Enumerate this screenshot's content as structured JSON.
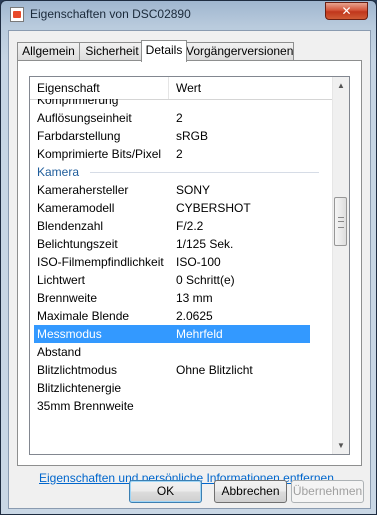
{
  "window": {
    "title": "Eigenschaften von DSC02890",
    "close_label": "✕",
    "close_icon": "close-icon"
  },
  "tabs": [
    {
      "label": "Allgemein"
    },
    {
      "label": "Sicherheit"
    },
    {
      "label": "Details"
    },
    {
      "label": "Vorgängerversionen"
    }
  ],
  "table": {
    "header": {
      "property": "Eigenschaft",
      "value": "Wert"
    },
    "rows": [
      {
        "k": "Komprimierung",
        "v": ""
      },
      {
        "k": "Auflösungseinheit",
        "v": "2"
      },
      {
        "k": "Farbdarstellung",
        "v": "sRGB"
      },
      {
        "k": "Komprimierte Bits/Pixel",
        "v": "2"
      },
      {
        "k": "Kamerahersteller",
        "v": "SONY"
      },
      {
        "k": "Kameramodell",
        "v": "CYBERSHOT"
      },
      {
        "k": "Blendenzahl",
        "v": "F/2.2"
      },
      {
        "k": "Belichtungszeit",
        "v": "1/125 Sek."
      },
      {
        "k": "ISO-Filmempfindlichkeit",
        "v": "ISO-100"
      },
      {
        "k": "Lichtwert",
        "v": "0 Schritt(e)"
      },
      {
        "k": "Brennweite",
        "v": "13 mm"
      },
      {
        "k": "Maximale Blende",
        "v": "2.0625"
      },
      {
        "k": "Messmodus",
        "v": "Mehrfeld"
      },
      {
        "k": "Abstand",
        "v": ""
      },
      {
        "k": "Blitzlichtmodus",
        "v": "Ohne Blitzlicht"
      },
      {
        "k": "Blitzlichtenergie",
        "v": ""
      },
      {
        "k": "35mm Brennweite",
        "v": ""
      }
    ],
    "group_label": "Kamera",
    "selected_row": "Messmodus"
  },
  "link_text": "Eigenschaften und persönliche Informationen entfernen",
  "buttons": {
    "ok": "OK",
    "cancel": "Abbrechen",
    "apply": "Übernehmen"
  },
  "colors": {
    "selection": "#3399ff",
    "group": "#1e5c9a",
    "link": "#0066cc"
  }
}
